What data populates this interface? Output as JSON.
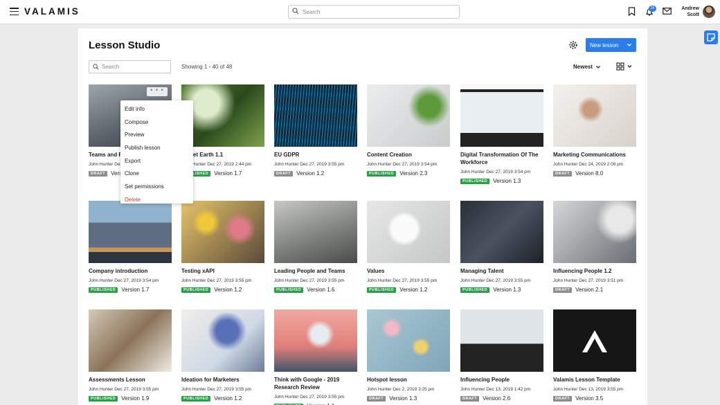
{
  "header": {
    "logo": "VALAMIS",
    "search_placeholder": "Search",
    "notification_count": "26",
    "user_first": "Andrew",
    "user_last": "Scott"
  },
  "page": {
    "title": "Lesson Studio",
    "new_lesson_label": "New lesson",
    "search_placeholder": "Search",
    "showing": "Showing 1 - 40 of 48",
    "sort": "Newest"
  },
  "context_menu": [
    "Edit info",
    "Compose",
    "Preview",
    "Publish lesson",
    "Export",
    "Clone",
    "Set permissions",
    "Delete"
  ],
  "colors": {
    "accent": "#2b7de9",
    "published": "#27a043",
    "draft": "#8c8c8c",
    "danger": "#e0392b"
  },
  "lessons": [
    {
      "title": "Teams and Roles",
      "meta": "John Hunter Dec 27, 2019 3:55 pm",
      "status": "DRAFT",
      "version": "Version 1.1"
    },
    {
      "title": "Planet Earth 1.1",
      "meta": "John Hunter Dec 27, 2019 2:44 pm",
      "status": "PUBLISHED",
      "version": "Version 1.7"
    },
    {
      "title": "EU GDPR",
      "meta": "John Hunter Dec 27, 2019 3:55 pm",
      "status": "DRAFT",
      "version": "Version 1.2"
    },
    {
      "title": "Content Creation",
      "meta": "John Hunter Dec 27, 2019 3:54 pm",
      "status": "PUBLISHED",
      "version": "Version 2.3"
    },
    {
      "title": "Digital Transformation Of The Workforce",
      "meta": "John Hunter Dec 27, 2019 3:54 pm",
      "status": "PUBLISHED",
      "version": "Version 1.3"
    },
    {
      "title": "Marketing Communications",
      "meta": "John Hunter Dec 24, 2019 2:08 pm",
      "status": "DRAFT",
      "version": "Version 8.0"
    },
    {
      "title": "Company introduction",
      "meta": "John Hunter Dec 27, 2019 3:54 pm",
      "status": "PUBLISHED",
      "version": "Version 1.7"
    },
    {
      "title": "Testing xAPI",
      "meta": "John Hunter Dec 27, 2019 3:55 pm",
      "status": "PUBLISHED",
      "version": "Version 1.2"
    },
    {
      "title": "Leading People and Teams",
      "meta": "John Hunter Dec 27, 2019 3:55 pm",
      "status": "PUBLISHED",
      "version": "Version 1.6"
    },
    {
      "title": "Values",
      "meta": "John Hunter Dec 27, 2019 3:55 pm",
      "status": "PUBLISHED",
      "version": "Version 1.2"
    },
    {
      "title": "Managing Talent",
      "meta": "John Hunter Dec 27, 2019 3:55 pm",
      "status": "PUBLISHED",
      "version": "Version 1.3"
    },
    {
      "title": "Influencing People 1.2",
      "meta": "John Hunter Dec 27, 2019 3:51 pm",
      "status": "DRAFT",
      "version": "Version 2.1"
    },
    {
      "title": "Assessments Lesson",
      "meta": "John Hunter Dec 27, 2019 3:55 pm",
      "status": "PUBLISHED",
      "version": "Version 1.9"
    },
    {
      "title": "Ideation for Marketers",
      "meta": "John Hunter Dec 27, 2019 3:55 pm",
      "status": "PUBLISHED",
      "version": "Version 1.2"
    },
    {
      "title": "Think with Google - 2019 Research Review",
      "meta": "John Hunter Dec 27, 2019 3:55 pm",
      "status": "PUBLISHED",
      "version": "Version 1.1"
    },
    {
      "title": "Hotspot lesson",
      "meta": "John Hunter Dec 2, 2019 3:25 pm",
      "status": "DRAFT",
      "version": "Version 1.3"
    },
    {
      "title": "Influencing People",
      "meta": "John Hunter Dec 13, 2019 1:42 pm",
      "status": "DRAFT",
      "version": "Version 2.6"
    },
    {
      "title": "Valamis Lesson Template",
      "meta": "John Hunter Dec 13, 2019 3:55 pm",
      "status": "DRAFT",
      "version": "Version 3.5"
    }
  ]
}
